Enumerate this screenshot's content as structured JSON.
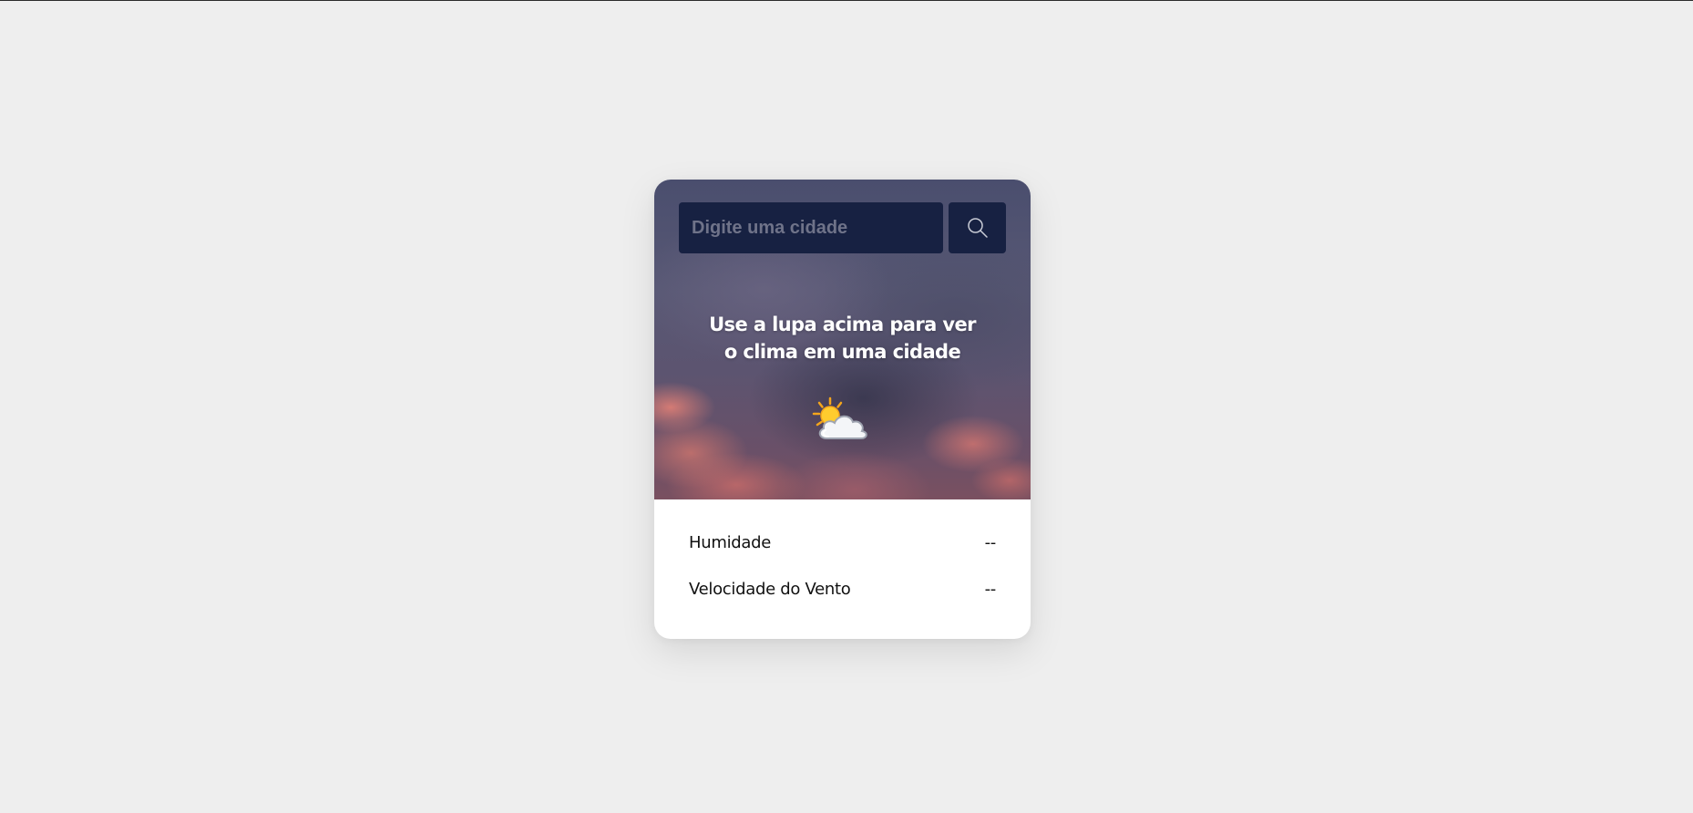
{
  "search": {
    "placeholder": "Digite uma cidade",
    "value": "",
    "button_icon": "search-icon"
  },
  "hero": {
    "message": "Use a lupa acima para ver o clima em uma cidade",
    "weather_icon": "sun-behind-cloud-icon"
  },
  "details": [
    {
      "label": "Humidade",
      "value": "--"
    },
    {
      "label": "Velocidade do Vento",
      "value": "--"
    }
  ],
  "colors": {
    "page_background": "#eeeeee",
    "card_background": "#ffffff",
    "input_background": "#172142",
    "placeholder_text": "#6f7389",
    "hero_text": "#ffffff",
    "detail_text": "#111111"
  }
}
